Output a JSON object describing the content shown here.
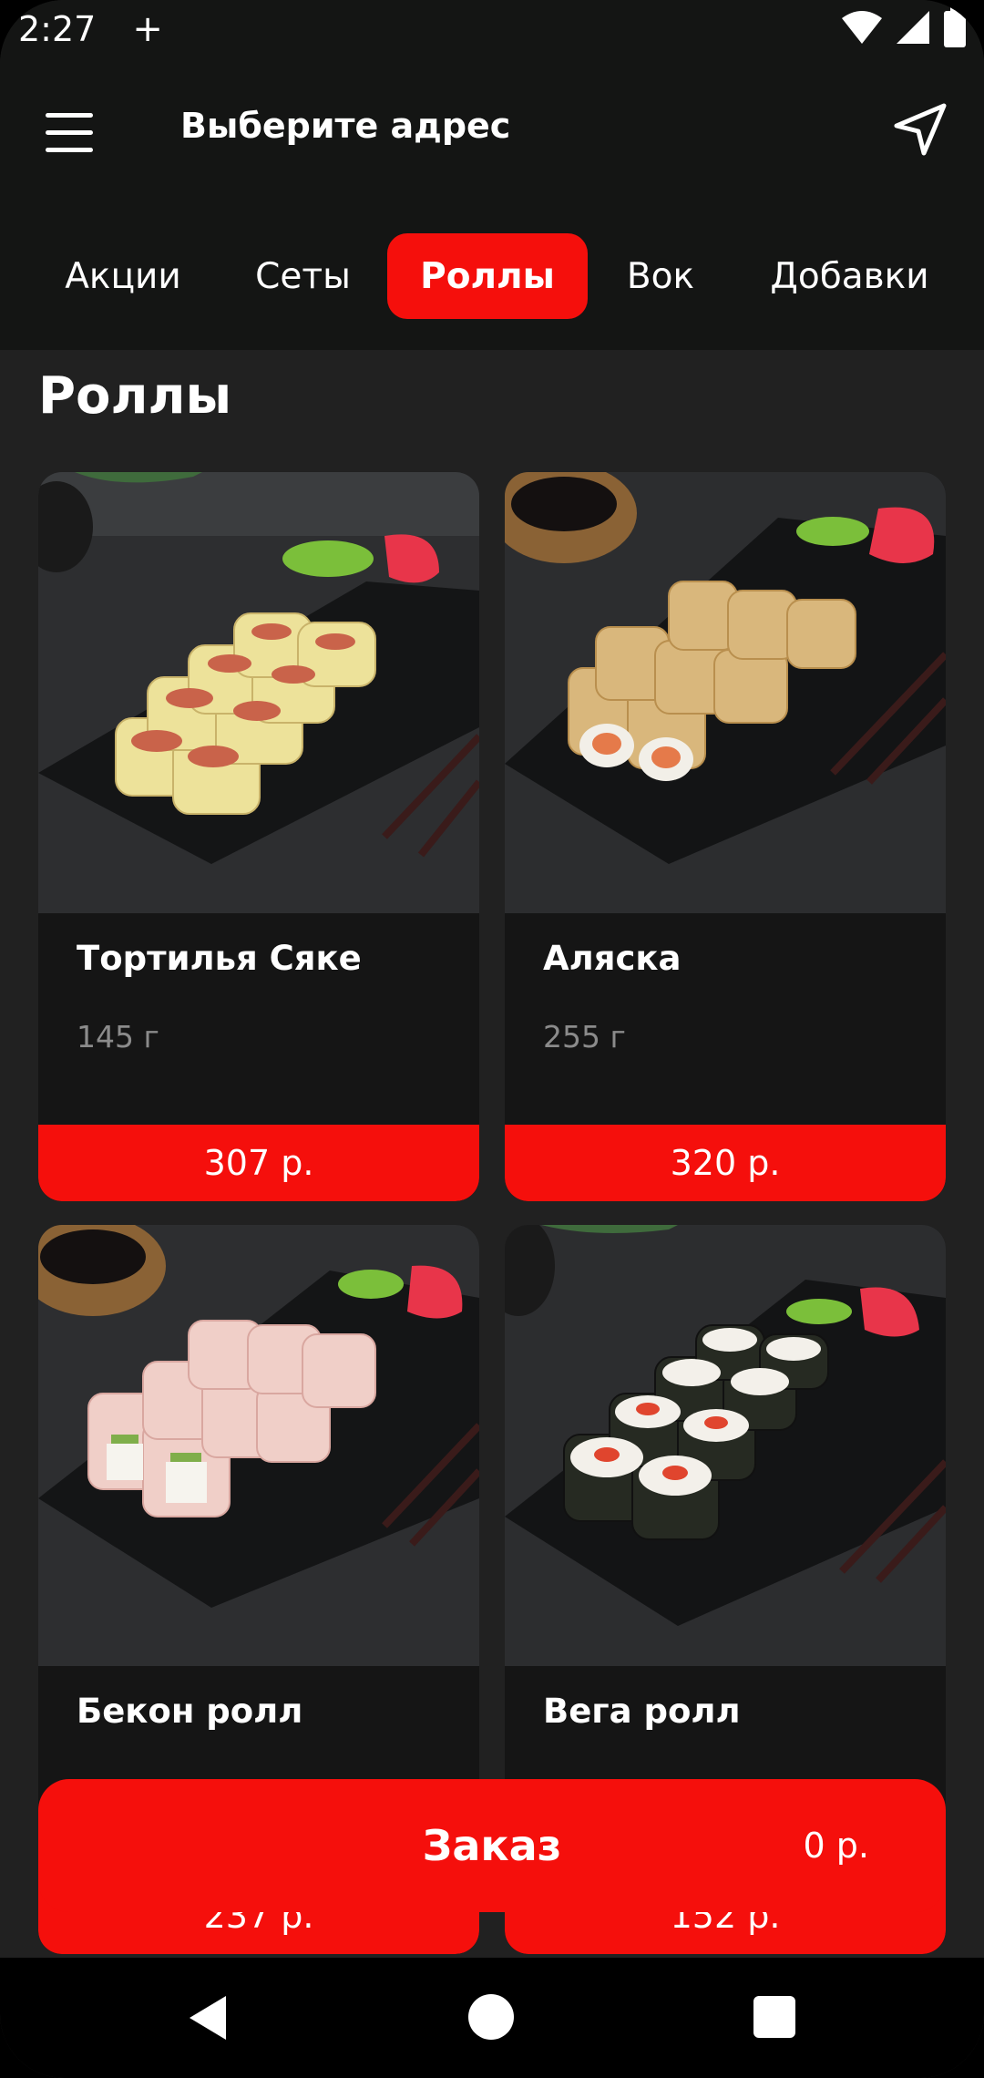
{
  "status_bar": {
    "time": "2:27",
    "plus": "+"
  },
  "header": {
    "address_placeholder": "Выберите адрес"
  },
  "tabs": [
    {
      "label": "Акции",
      "active": false
    },
    {
      "label": "Сеты",
      "active": false
    },
    {
      "label": "Роллы",
      "active": true
    },
    {
      "label": "Вок",
      "active": false
    },
    {
      "label": "Добавки",
      "active": false
    }
  ],
  "section_title": "Роллы",
  "products": [
    {
      "name": "Тортилья Сяке",
      "weight": "145 г",
      "price": "307 р."
    },
    {
      "name": "Аляска",
      "weight": "255 г",
      "price": "320 р."
    },
    {
      "name": "Бекон ролл",
      "weight": "",
      "price": "237 р."
    },
    {
      "name": "Вега ролл",
      "weight": "",
      "price": "152 р."
    }
  ],
  "order": {
    "label": "Заказ",
    "total": "0 р."
  },
  "colors": {
    "accent": "#f50f0c",
    "header_bg": "#141514",
    "page_bg": "#212121",
    "card_bg": "#151515"
  },
  "icons": [
    "hamburger-menu-icon",
    "navigation-arrow-icon",
    "wifi-icon",
    "signal-icon",
    "battery-icon",
    "back-icon",
    "home-icon",
    "recents-icon"
  ]
}
